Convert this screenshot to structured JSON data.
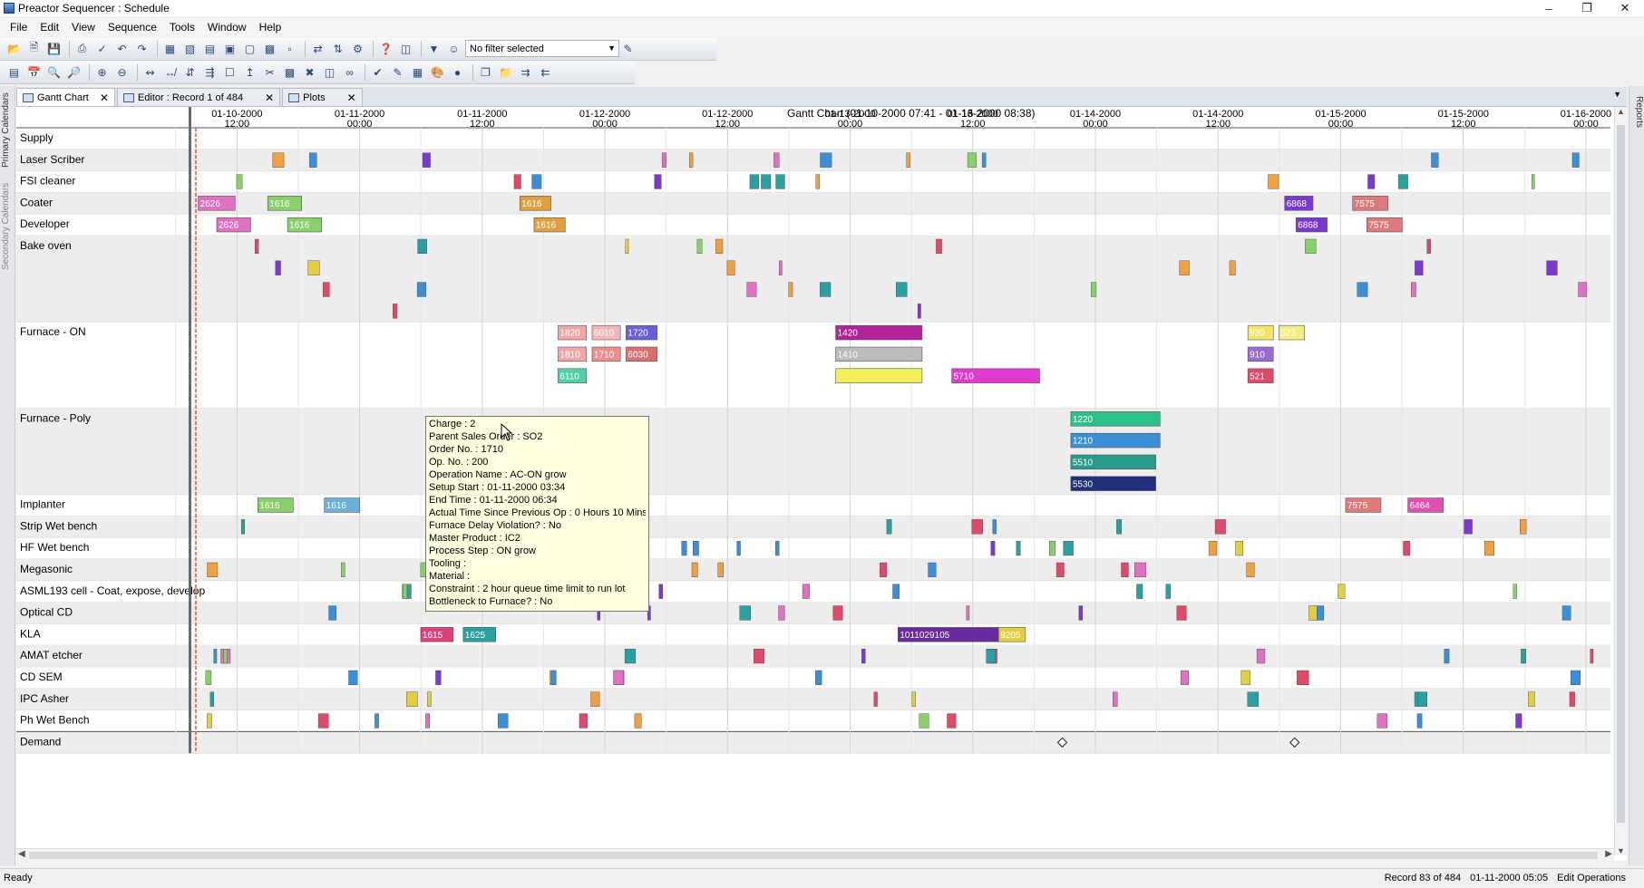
{
  "window": {
    "title": "Preactor Sequencer : Schedule",
    "controls": [
      "–",
      "❐",
      "✕"
    ]
  },
  "menu": [
    "File",
    "Edit",
    "View",
    "Sequence",
    "Tools",
    "Window",
    "Help"
  ],
  "toolbar": {
    "filter_text": "No filter selected"
  },
  "side_tabs": {
    "left": [
      "Primary Calendars",
      "Secondary Calendars"
    ],
    "right": [
      "Reports"
    ]
  },
  "tabs": [
    {
      "label": "Gantt Chart",
      "active": true
    },
    {
      "label": "Editor : Record 1 of 484",
      "active": false
    },
    {
      "label": "Plots",
      "active": false
    }
  ],
  "gantt": {
    "title": "Gantt Chart   (01-10-2000 07:41 - 01-16-2000 08:38)",
    "time_labels": [
      {
        "date": "01-10-2000",
        "time": "12:00"
      },
      {
        "date": "01-11-2000",
        "time": "00:00"
      },
      {
        "date": "01-11-2000",
        "time": "12:00"
      },
      {
        "date": "01-12-2000",
        "time": "00:00"
      },
      {
        "date": "01-12-2000",
        "time": "12:00"
      },
      {
        "date": "01-13-2000",
        "time": "00:00"
      },
      {
        "date": "01-13-2000",
        "time": "12:00"
      },
      {
        "date": "01-14-2000",
        "time": "00:00"
      },
      {
        "date": "01-14-2000",
        "time": "12:00"
      },
      {
        "date": "01-15-2000",
        "time": "00:00"
      },
      {
        "date": "01-15-2000",
        "time": "12:00"
      },
      {
        "date": "01-16-2000",
        "time": "00:00"
      }
    ],
    "resources": [
      {
        "name": "Supply",
        "lanes": 1
      },
      {
        "name": "Laser Scriber",
        "lanes": 1
      },
      {
        "name": "FSI cleaner",
        "lanes": 1
      },
      {
        "name": "Coater",
        "lanes": 1
      },
      {
        "name": "Developer",
        "lanes": 1
      },
      {
        "name": "Bake oven",
        "lanes": 4
      },
      {
        "name": "Furnace - ON",
        "lanes": 4
      },
      {
        "name": "Furnace - Poly",
        "lanes": 4
      },
      {
        "name": "Implanter",
        "lanes": 1
      },
      {
        "name": "Strip Wet bench",
        "lanes": 1
      },
      {
        "name": "HF Wet bench",
        "lanes": 1
      },
      {
        "name": "Megasonic",
        "lanes": 1
      },
      {
        "name": "ASML193 cell - Coat, expose, develop",
        "lanes": 1
      },
      {
        "name": "Optical CD",
        "lanes": 1
      },
      {
        "name": "KLA",
        "lanes": 1
      },
      {
        "name": "AMAT etcher",
        "lanes": 1
      },
      {
        "name": "CD SEM",
        "lanes": 1
      },
      {
        "name": "IPC Asher",
        "lanes": 1
      },
      {
        "name": "Ph Wet Bench",
        "lanes": 1
      },
      {
        "name": "Demand",
        "lanes": 1
      }
    ],
    "bars": [
      {
        "res": "Furnace - ON",
        "lane": 0,
        "start": 0.257,
        "end": 0.277,
        "label": "1820",
        "color": "#f2a7a7"
      },
      {
        "res": "Furnace - ON",
        "lane": 0,
        "start": 0.281,
        "end": 0.301,
        "label": "6010",
        "color": "#f0b8b8"
      },
      {
        "res": "Furnace - ON",
        "lane": 0,
        "start": 0.305,
        "end": 0.327,
        "label": "1720",
        "color": "#6b5fd6"
      },
      {
        "res": "Furnace - ON",
        "lane": 0,
        "start": 0.453,
        "end": 0.514,
        "label": "1420",
        "color": "#b2239a"
      },
      {
        "res": "Furnace - ON",
        "lane": 0,
        "start": 0.744,
        "end": 0.762,
        "label": "920",
        "color": "#f5e66a"
      },
      {
        "res": "Furnace - ON",
        "lane": 0,
        "start": 0.766,
        "end": 0.784,
        "label": "523",
        "color": "#f3ed82"
      },
      {
        "res": "Furnace - ON",
        "lane": 1,
        "start": 0.257,
        "end": 0.277,
        "label": "1810",
        "color": "#f2a7a7"
      },
      {
        "res": "Furnace - ON",
        "lane": 1,
        "start": 0.281,
        "end": 0.301,
        "label": "1710",
        "color": "#f08c8c"
      },
      {
        "res": "Furnace - ON",
        "lane": 1,
        "start": 0.305,
        "end": 0.327,
        "label": "6030",
        "color": "#d87070"
      },
      {
        "res": "Furnace - ON",
        "lane": 1,
        "start": 0.453,
        "end": 0.514,
        "label": "1410",
        "color": "#bbbbbb"
      },
      {
        "res": "Furnace - ON",
        "lane": 1,
        "start": 0.744,
        "end": 0.762,
        "label": "910",
        "color": "#9b6bd4"
      },
      {
        "res": "Furnace - ON",
        "lane": 2,
        "start": 0.257,
        "end": 0.277,
        "label": "6110",
        "color": "#4fd1a0"
      },
      {
        "res": "Furnace - ON",
        "lane": 2,
        "start": 0.535,
        "end": 0.597,
        "label": "5710",
        "color": "#e03ad0"
      },
      {
        "res": "Furnace - ON",
        "lane": 2,
        "start": 0.744,
        "end": 0.762,
        "label": "521",
        "color": "#e04a6a"
      },
      {
        "res": "Furnace - ON",
        "lane": 2,
        "start": 0.453,
        "end": 0.514,
        "label": "",
        "color": "#f3ef5a"
      },
      {
        "res": "Furnace - Poly",
        "lane": 0,
        "start": 0.619,
        "end": 0.682,
        "label": "1220",
        "color": "#2ec08a"
      },
      {
        "res": "Furnace - Poly",
        "lane": 1,
        "start": 0.619,
        "end": 0.682,
        "label": "1210",
        "color": "#3a8fd8"
      },
      {
        "res": "Furnace - Poly",
        "lane": 2,
        "start": 0.619,
        "end": 0.679,
        "label": "5510",
        "color": "#2a9a8a"
      },
      {
        "res": "Furnace - Poly",
        "lane": 3,
        "start": 0.619,
        "end": 0.679,
        "label": "5530",
        "color": "#20307a"
      },
      {
        "res": "Implanter",
        "lane": 0,
        "start": 0.045,
        "end": 0.07,
        "label": "1616",
        "color": "#8ad06a"
      },
      {
        "res": "Implanter",
        "lane": 0,
        "start": 0.092,
        "end": 0.117,
        "label": "1616",
        "color": "#6ab0d8"
      },
      {
        "res": "Implanter",
        "lane": 0,
        "start": 0.813,
        "end": 0.838,
        "label": "7575",
        "color": "#e07a7a"
      },
      {
        "res": "Implanter",
        "lane": 0,
        "start": 0.857,
        "end": 0.882,
        "label": "6464",
        "color": "#e050b0"
      },
      {
        "res": "Coater",
        "lane": 0,
        "start": 0.003,
        "end": 0.029,
        "label": "2626",
        "color": "#e070c0"
      },
      {
        "res": "Coater",
        "lane": 0,
        "start": 0.052,
        "end": 0.076,
        "label": "1616",
        "color": "#8ad06a"
      },
      {
        "res": "Coater",
        "lane": 0,
        "start": 0.23,
        "end": 0.252,
        "label": "1616",
        "color": "#e0a040"
      },
      {
        "res": "Coater",
        "lane": 0,
        "start": 0.77,
        "end": 0.79,
        "label": "6868",
        "color": "#7a3ad0"
      },
      {
        "res": "Coater",
        "lane": 0,
        "start": 0.818,
        "end": 0.843,
        "label": "7575",
        "color": "#e07a7a"
      },
      {
        "res": "Developer",
        "lane": 0,
        "start": 0.016,
        "end": 0.04,
        "label": "2626",
        "color": "#e070c0"
      },
      {
        "res": "Developer",
        "lane": 0,
        "start": 0.066,
        "end": 0.09,
        "label": "1616",
        "color": "#8ad06a"
      },
      {
        "res": "Developer",
        "lane": 0,
        "start": 0.24,
        "end": 0.262,
        "label": "1616",
        "color": "#e0a040"
      },
      {
        "res": "Developer",
        "lane": 0,
        "start": 0.778,
        "end": 0.8,
        "label": "6868",
        "color": "#7a3ad0"
      },
      {
        "res": "Developer",
        "lane": 0,
        "start": 0.828,
        "end": 0.853,
        "label": "7575",
        "color": "#e07a7a"
      },
      {
        "res": "KLA",
        "lane": 0,
        "start": 0.16,
        "end": 0.183,
        "label": "1615",
        "color": "#e0407a"
      },
      {
        "res": "KLA",
        "lane": 0,
        "start": 0.19,
        "end": 0.213,
        "label": "1625",
        "color": "#2aa0a0"
      },
      {
        "res": "KLA",
        "lane": 0,
        "start": 0.497,
        "end": 0.568,
        "label": "1011029105",
        "color": "#6a2aa0"
      },
      {
        "res": "KLA",
        "lane": 0,
        "start": 0.568,
        "end": 0.587,
        "label": "9205",
        "color": "#e0d040"
      }
    ],
    "demand_markers": [
      0.613,
      0.777
    ]
  },
  "tooltip": {
    "lines": [
      "Charge : 2",
      "Parent Sales Order : SO2",
      "Order No. : 1710",
      "Op. No. : 200",
      "Operation Name : AC-ON grow",
      "Setup Start : 01-11-2000 03:34",
      "End Time : 01-11-2000 06:34",
      "Actual Time Since Previous Op : 0 Hours 10 Mins",
      "Furnace Delay Violation? : No",
      "Master Product : IC2",
      "Process Step : ON grow",
      "Tooling :",
      "Material :",
      "Constraint : 2 hour queue time limit to run lot",
      "Bottleneck to Furnace? : No"
    ]
  },
  "status": {
    "left": "Ready",
    "record": "Record 83 of 484",
    "datetime": "01-11-2000 05:05",
    "mode": "Edit Operations"
  },
  "colors": {
    "row_alt": "#ededed",
    "grid": "#d4d4d4",
    "now_line": "#e05050",
    "tooltip_bg": "#ffffe1"
  }
}
